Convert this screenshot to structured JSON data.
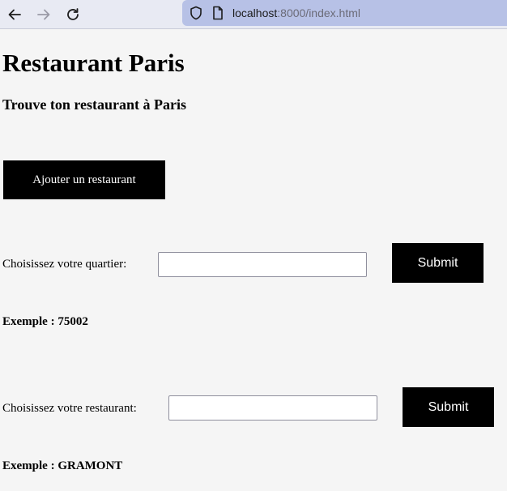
{
  "browser": {
    "url_host": "localhost",
    "url_rest": ":8000/index.html"
  },
  "page": {
    "title": "Restaurant Paris",
    "subtitle": "Trouve ton restaurant à Paris",
    "add_button": "Ajouter un restaurant"
  },
  "forms": {
    "quartier": {
      "label": "Choisissez votre quartier:",
      "value": "",
      "submit": "Submit",
      "example": "Exemple : 75002"
    },
    "restaurant": {
      "label": "Choisissez votre restaurant:",
      "value": "",
      "submit": "Submit",
      "example": "Exemple : GRAMONT"
    }
  },
  "icons": [
    "back-arrow-icon",
    "forward-arrow-icon",
    "reload-icon",
    "shield-icon",
    "page-icon"
  ]
}
